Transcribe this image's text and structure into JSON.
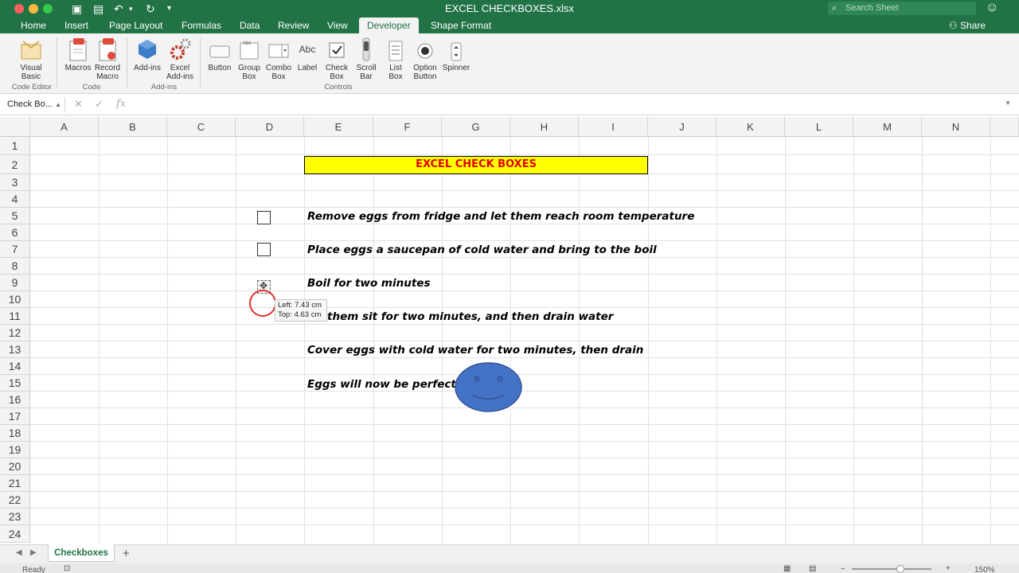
{
  "window": {
    "title": "EXCEL CHECKBOXES.xlsx",
    "search_placeholder": "Search Sheet"
  },
  "tabs": [
    "Home",
    "Insert",
    "Page Layout",
    "Formulas",
    "Data",
    "Review",
    "View",
    "Developer",
    "Shape Format"
  ],
  "active_tab": "Developer",
  "share_label": "Share",
  "ribbon": {
    "code_editor": {
      "visual_basic": [
        "Visual",
        "Basic"
      ],
      "label": "Code Editor"
    },
    "code": {
      "macros": "Macros",
      "record_macro": [
        "Record",
        "Macro"
      ],
      "label": "Code"
    },
    "addins": {
      "addins": "Add-ins",
      "excel_addins": [
        "Excel",
        "Add-ins"
      ],
      "label": "Add-ins"
    },
    "controls": {
      "button": "Button",
      "group_box": [
        "Group",
        "Box"
      ],
      "combo_box": [
        "Combo",
        "Box"
      ],
      "label": "Label",
      "label_icon_text": "Abc",
      "check_box": [
        "Check",
        "Box"
      ],
      "scroll_bar": [
        "Scroll",
        "Bar"
      ],
      "list_box": [
        "List",
        "Box"
      ],
      "option_button": [
        "Option",
        "Button"
      ],
      "spinner": "Spinner",
      "group_label": "Controls"
    }
  },
  "formula_bar": {
    "name_box": "Check Bo...",
    "fx": "fx",
    "value": ""
  },
  "columns": [
    "A",
    "B",
    "C",
    "D",
    "E",
    "F",
    "G",
    "H",
    "I",
    "J",
    "K",
    "L",
    "M",
    "N"
  ],
  "rows": [
    "1",
    "2",
    "3",
    "4",
    "5",
    "6",
    "7",
    "8",
    "9",
    "10",
    "11",
    "12",
    "13",
    "14",
    "15",
    "16",
    "17",
    "18",
    "19",
    "20",
    "21",
    "22",
    "23",
    "24"
  ],
  "sheet": {
    "title": "EXCEL CHECK BOXES",
    "tasks": [
      "Remove  eggs from fridge and let them reach room temperature",
      "Place eggs a saucepan of cold water and bring to the boil",
      "Boil for two minutes",
      "them sit for two minutes, and then drain water",
      "Cover eggs with cold water for two minutes, then drain",
      "Eggs will now be perfect !!"
    ],
    "title_bg": "#ffff00",
    "title_color": "#e00000",
    "face_color": "#4472c4"
  },
  "tooltip": {
    "left": "Left: 7.43 cm",
    "top": "Top: 4.63 cm"
  },
  "sheet_tabs": [
    "Checkboxes"
  ],
  "status": {
    "ready": "Ready",
    "zoom": "150%"
  }
}
